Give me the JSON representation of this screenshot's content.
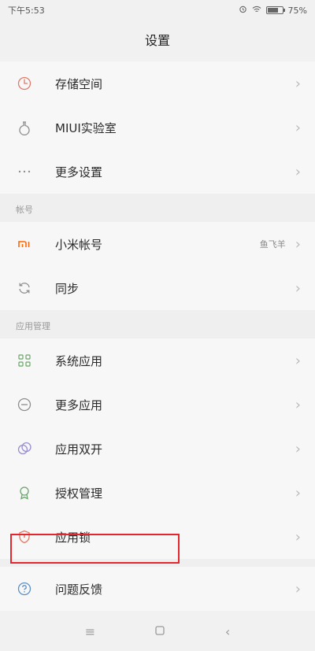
{
  "status": {
    "time": "下午5:53",
    "battery_pct": "75%",
    "battery_level": 0.75
  },
  "header": {
    "title": "设置"
  },
  "groups": [
    {
      "header": "",
      "items": [
        {
          "label": "存储空间",
          "icon": "storage-icon"
        },
        {
          "label": "MIUI实验室",
          "icon": "lab-flask-icon"
        },
        {
          "label": "更多设置",
          "icon": "more-dots-icon"
        }
      ]
    },
    {
      "header": "帐号",
      "items": [
        {
          "label": "小米帐号",
          "icon": "mi-logo-icon",
          "value": "鱼飞羊"
        },
        {
          "label": "同步",
          "icon": "sync-icon"
        }
      ]
    },
    {
      "header": "应用管理",
      "items": [
        {
          "label": "系统应用",
          "icon": "grid-apps-icon"
        },
        {
          "label": "更多应用",
          "icon": "more-apps-icon"
        },
        {
          "label": "应用双开",
          "icon": "dual-apps-icon"
        },
        {
          "label": "授权管理",
          "icon": "permission-badge-icon"
        },
        {
          "label": "应用锁",
          "icon": "app-lock-icon",
          "highlighted": true
        }
      ]
    },
    {
      "header": "",
      "items": [
        {
          "label": "问题反馈",
          "icon": "feedback-question-icon"
        }
      ]
    }
  ],
  "colors": {
    "highlight": "#e4262f",
    "mi_orange": "#ff6700",
    "icon_gray": "#8e8e8e"
  }
}
